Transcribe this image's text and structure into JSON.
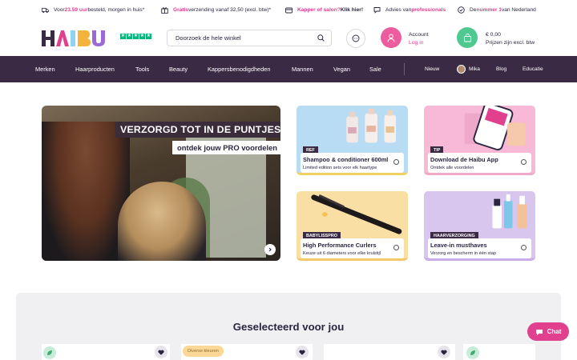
{
  "usp": [
    {
      "icon": "truck-icon",
      "pre": "Voor ",
      "highlight": "23.59 uur",
      "post": " besteld, morgen in huis*"
    },
    {
      "icon": "gift-icon",
      "pre": "",
      "highlight": "Gratis",
      "post": " verzending vanaf 32,50 (excl. btw)*"
    },
    {
      "icon": "card-icon",
      "pre": "",
      "highlight": "Kapper of salon?",
      "post": " Klik hier!"
    },
    {
      "icon": "chat-icon",
      "pre": "Advies van ",
      "highlight": "professionals",
      "post": ""
    },
    {
      "icon": "check-circle-icon",
      "pre": "De ",
      "highlight": "nummer 1",
      "post": " van Nederland"
    }
  ],
  "header": {
    "logo": "HAIBU",
    "search_placeholder": "Doorzoek de hele winkel",
    "account_label": "Account",
    "login_label": "Log in",
    "cart_total": "€ 0,00",
    "cart_note": "Prijzen zijn excl. btw"
  },
  "nav": {
    "main": [
      "Merken",
      "Haarproducten",
      "Tools",
      "Beauty",
      "Kappersbenodigdheden",
      "Mannen",
      "Vegan",
      "Sale"
    ],
    "secondary": [
      "Nieuw",
      "Mika",
      "Blog",
      "Educatie"
    ]
  },
  "hero": {
    "line1": "VERZORGD TOT IN DE PUNTJES",
    "line2": "ontdek jouw PRO voordelen"
  },
  "cards": [
    {
      "tag": "REF",
      "title": "Shampoo & conditioner 600ml",
      "subtitle": "Limited edition sets voor elk haartype"
    },
    {
      "tag": "TIP",
      "title": "Download de Haibu App",
      "subtitle": "Ontdek alle voordelen"
    },
    {
      "tag": "BABYLISSPRO",
      "title": "High Performance Curlers",
      "subtitle": "Keuze uit 6 diameters voor elke krulstijl"
    },
    {
      "tag": "HAARVERZORGING",
      "title": "Leave-in musthaves",
      "subtitle": "Verzorg en bescherm in één stap"
    }
  ],
  "section": {
    "title": "Geselecteerd voor jou",
    "badge": "Diverse kleuren"
  },
  "chat": {
    "label": "Chat"
  },
  "colors": {
    "accent": "#e0408e",
    "nav_bg": "#3a2a43",
    "cart_green": "#4fc98f",
    "trustpilot": "#00b67a"
  }
}
